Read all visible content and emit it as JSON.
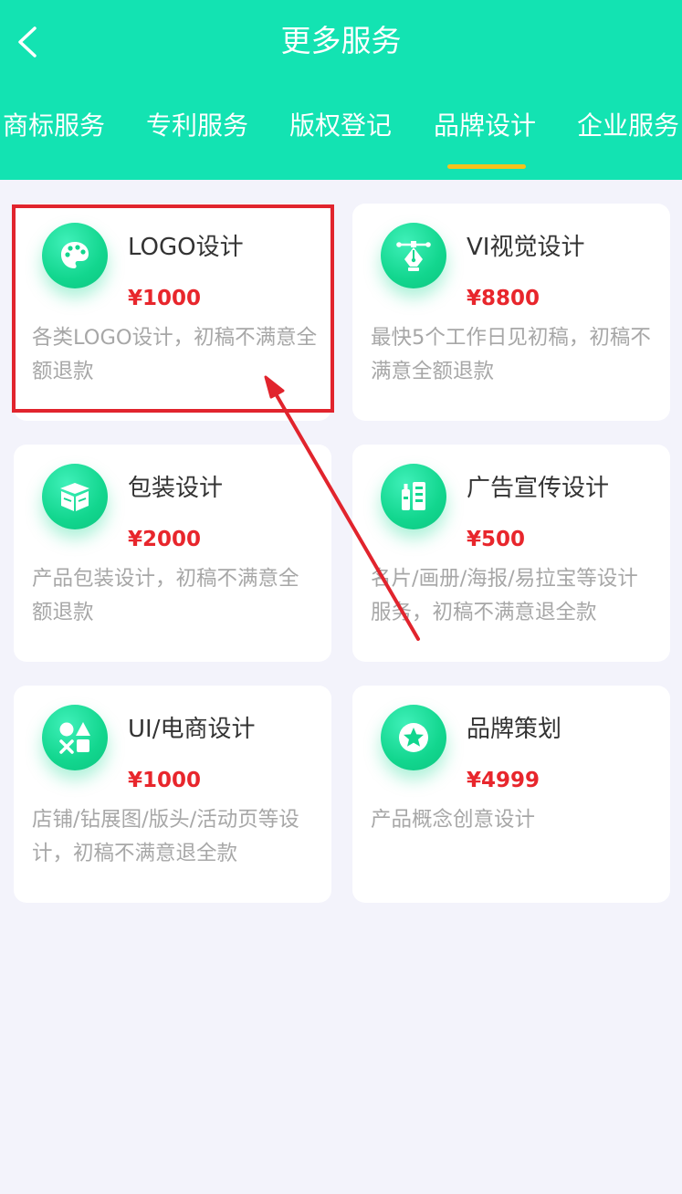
{
  "header": {
    "title": "更多服务",
    "back_icon": "chevron-left-icon",
    "background": "#13e3b2"
  },
  "tabs": [
    {
      "label": "商标服务",
      "active": false
    },
    {
      "label": "专利服务",
      "active": false
    },
    {
      "label": "版权登记",
      "active": false
    },
    {
      "label": "品牌设计",
      "active": true
    },
    {
      "label": "企业服务",
      "active": false
    }
  ],
  "tab_indicator_color": "#f6c21c",
  "cards": [
    {
      "title": "LOGO设计",
      "price": "¥1000",
      "desc": "各类LOGO设计，初稿不满意全额退款",
      "icon": "palette-icon"
    },
    {
      "title": "VI视觉设计",
      "price": "¥8800",
      "desc": "最快5个工作日见初稿，初稿不满意全额退款",
      "icon": "pen-nib-icon"
    },
    {
      "title": "包装设计",
      "price": "¥2000",
      "desc": "产品包装设计，初稿不满意全额退款",
      "icon": "box-icon"
    },
    {
      "title": "广告宣传设计",
      "price": "¥500",
      "desc": "名片/画册/海报/易拉宝等设计服务，初稿不满意退全款",
      "icon": "poster-icon"
    },
    {
      "title": "UI/电商设计",
      "price": "¥1000",
      "desc": "店铺/钻展图/版头/活动页等设计，初稿不满意退全款",
      "icon": "shapes-icon"
    },
    {
      "title": "品牌策划",
      "price": "¥4999",
      "desc": "产品概念创意设计",
      "icon": "star-badge-icon"
    }
  ],
  "colors": {
    "price": "#e8262c",
    "annotation": "#e1242d",
    "icon_green": "#12d68e"
  }
}
